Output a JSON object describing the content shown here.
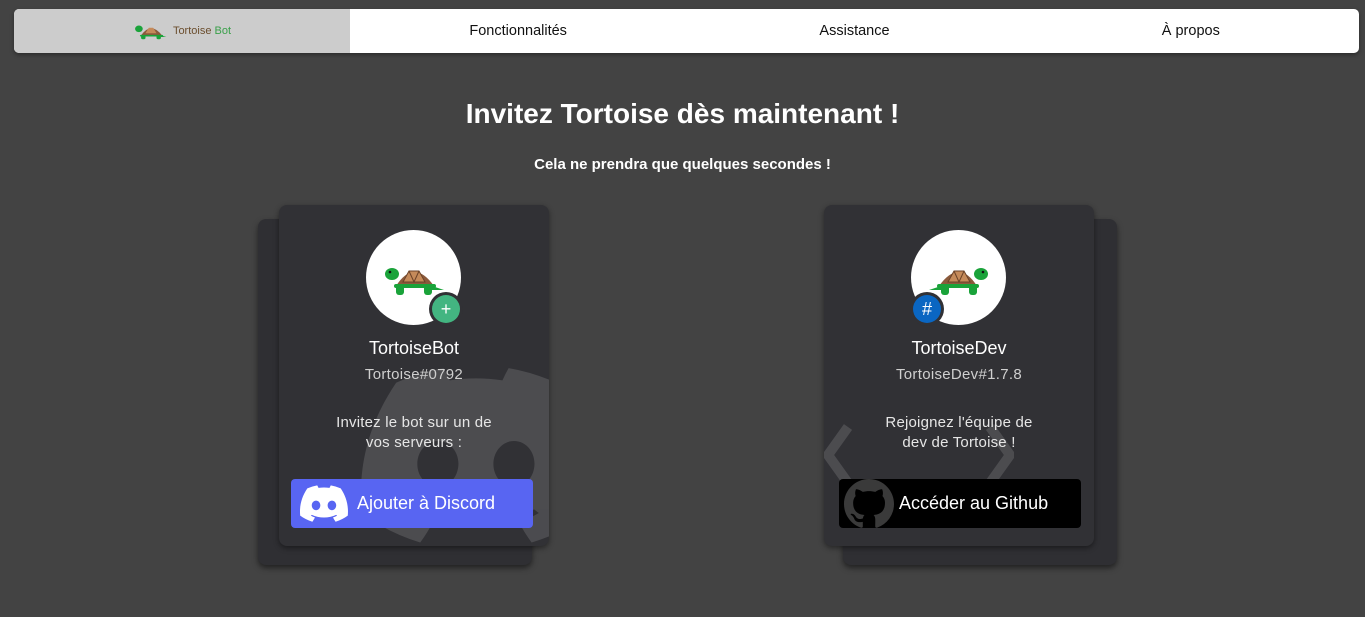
{
  "navbar": {
    "brand": {
      "name_part1": "Tortoise",
      "name_part2": "Bot"
    },
    "items": [
      {
        "label": "Fonctionnalités"
      },
      {
        "label": "Assistance"
      },
      {
        "label": "À propos"
      }
    ]
  },
  "hero": {
    "title": "Invitez Tortoise dès maintenant !",
    "subtitle": "Cela ne prendra que quelques secondes !"
  },
  "cards": [
    {
      "name": "TortoiseBot",
      "tag": "Tortoise#0792",
      "description_line1": "Invitez le bot sur un de",
      "description_line2": "vos serveurs :",
      "badge_icon": "plus-icon",
      "badge_symbol": "+",
      "badge_color": "#43b581",
      "button_label": "Ajouter à Discord",
      "button_icon": "discord-icon",
      "button_color": "#5865f2"
    },
    {
      "name": "TortoiseDev",
      "tag": "TortoiseDev#1.7.8",
      "description_line1": "Rejoignez l'équipe de",
      "description_line2": "dev de Tortoise !",
      "badge_icon": "hashtag-icon",
      "badge_symbol": "#",
      "badge_color": "#0a66c2",
      "button_label": "Accéder au Github",
      "button_icon": "github-icon",
      "button_color": "#000000"
    }
  ],
  "colors": {
    "page_background": "#434343",
    "card_background": "#313135",
    "navbar_background": "#ffffff",
    "brand_background": "#cccccc"
  }
}
